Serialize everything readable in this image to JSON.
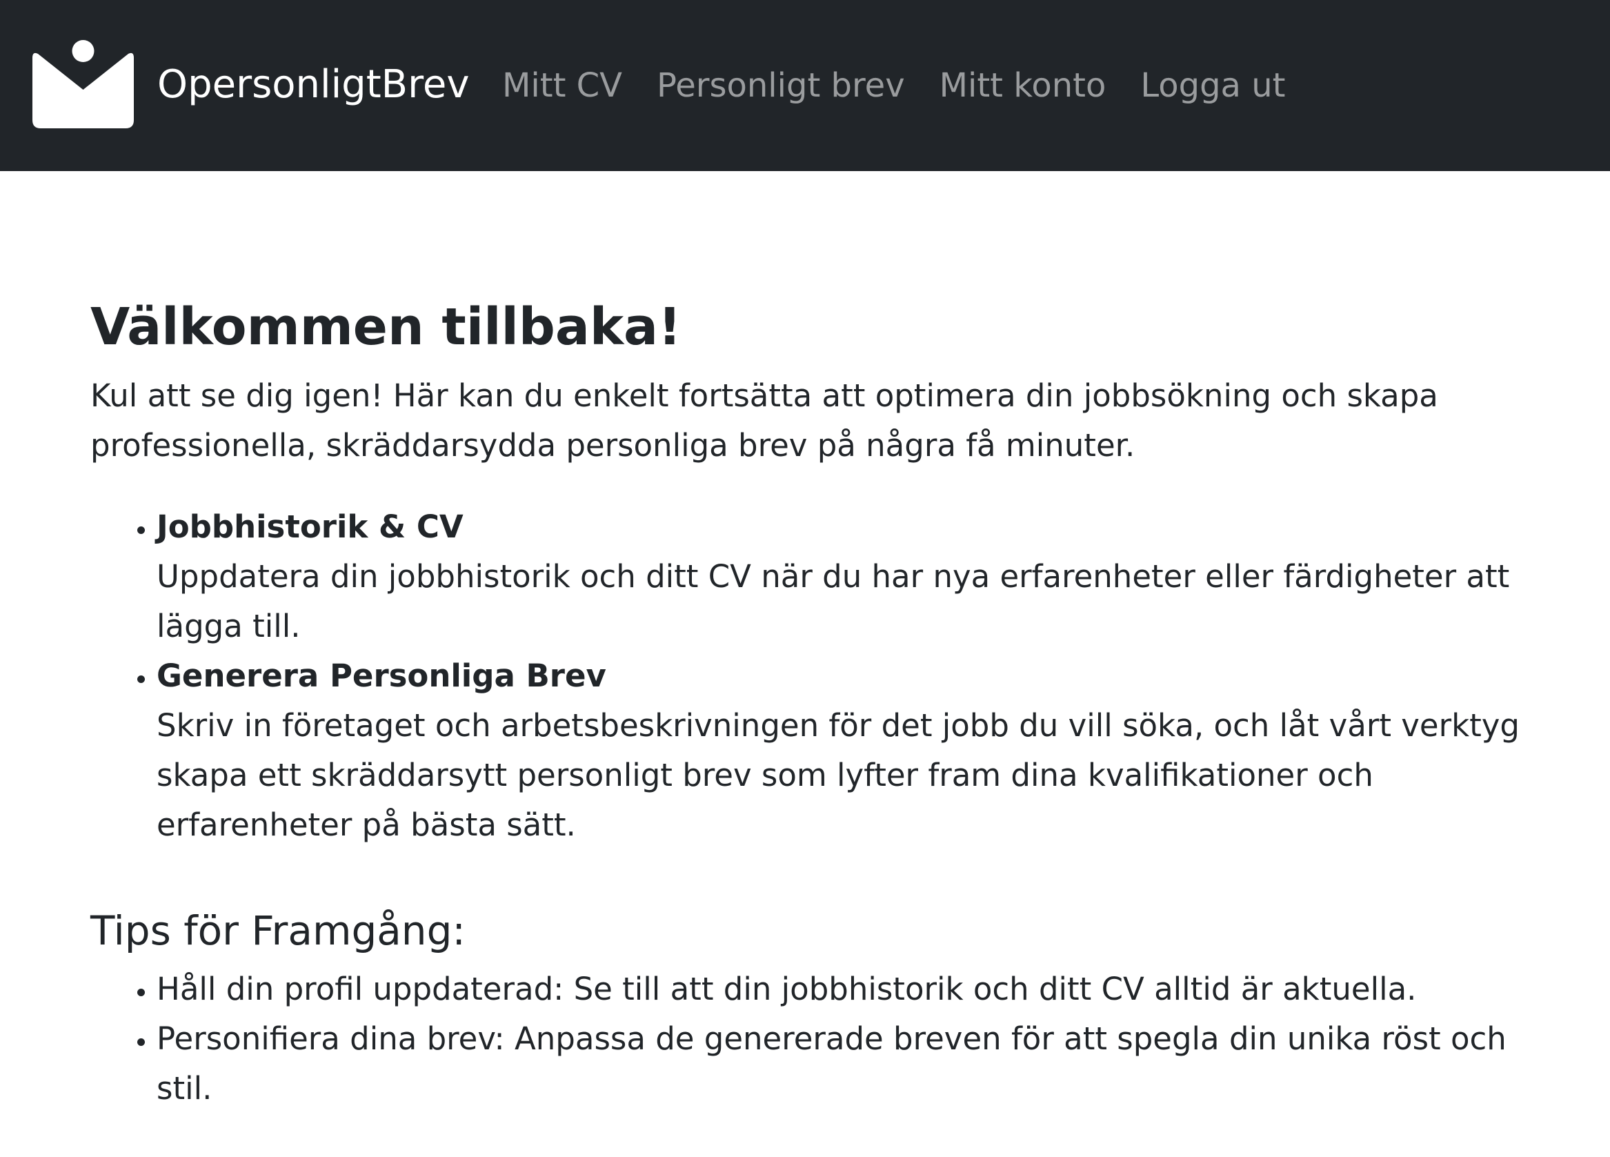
{
  "nav": {
    "brand": "OpersonligtBrev",
    "logo_icon": "envelope-person-icon",
    "links": [
      {
        "label": "Mitt CV"
      },
      {
        "label": "Personligt brev"
      },
      {
        "label": "Mitt konto"
      },
      {
        "label": "Logga ut"
      }
    ]
  },
  "main": {
    "title": "Välkommen tillbaka!",
    "intro": "Kul att se dig igen! Här kan du enkelt fortsätta att optimera din jobbsökning och skapa professionella, skräddarsydda personliga brev på några få minuter.",
    "features": [
      {
        "title": "Jobbhistorik & CV",
        "description": "Uppdatera din jobbhistorik och ditt CV när du har nya erfarenheter eller färdigheter att lägga till."
      },
      {
        "title": "Generera Personliga Brev",
        "description": "Skriv in företaget och arbetsbeskrivningen för det jobb du vill söka, och låt vårt verktyg skapa ett skräddarsytt personligt brev som lyfter fram dina kvalifikationer och erfarenheter på bästa sätt."
      }
    ],
    "tips_heading": "Tips för Framgång:",
    "tips": [
      "Håll din profil uppdaterad: Se till att din jobbhistorik och ditt CV alltid är aktuella.",
      "Personifiera dina brev: Anpassa de genererade breven för att spegla din unika röst och stil."
    ]
  },
  "colors": {
    "navbar_bg": "#212529",
    "nav_link": "rgba(255,255,255,0.55)",
    "brand_text": "#ffffff",
    "body_text": "#212529"
  }
}
